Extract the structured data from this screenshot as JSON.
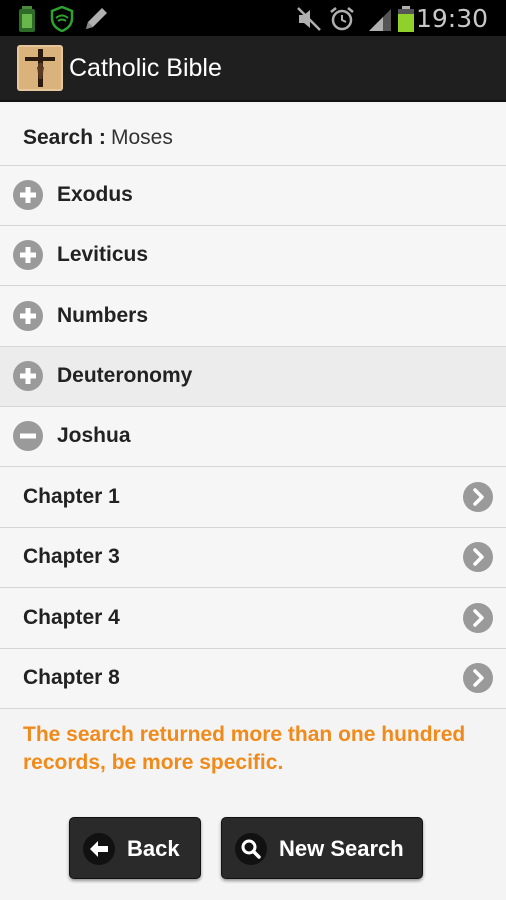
{
  "status_bar": {
    "time": "19:30",
    "icons": [
      "battery-app-icon",
      "shield-icon",
      "pencil-icon",
      "mute-icon",
      "alarm-icon",
      "signal-icon",
      "battery-icon"
    ]
  },
  "app_bar": {
    "title": "Catholic Bible",
    "logo_icon": "crucifix-icon"
  },
  "search": {
    "label": "Search :",
    "value": "Moses"
  },
  "books": [
    {
      "label": "Exodus",
      "state": "collapsed",
      "icon": "plus-circle-icon"
    },
    {
      "label": "Leviticus",
      "state": "collapsed",
      "icon": "plus-circle-icon"
    },
    {
      "label": "Numbers",
      "state": "collapsed",
      "icon": "plus-circle-icon"
    },
    {
      "label": "Deuteronomy",
      "state": "collapsed",
      "icon": "plus-circle-icon"
    },
    {
      "label": "Joshua",
      "state": "expanded",
      "icon": "minus-circle-icon"
    }
  ],
  "chapters": [
    {
      "label": "Chapter 1",
      "icon": "chevron-right-icon"
    },
    {
      "label": "Chapter 3",
      "icon": "chevron-right-icon"
    },
    {
      "label": "Chapter 4",
      "icon": "chevron-right-icon"
    },
    {
      "label": "Chapter 8",
      "icon": "chevron-right-icon"
    }
  ],
  "warning": "The search returned more than one hundred records, be more specific.",
  "buttons": {
    "back": {
      "label": "Back",
      "icon": "arrow-left-icon"
    },
    "new_search": {
      "label": "New Search",
      "icon": "magnifier-icon"
    }
  },
  "colors": {
    "action_bar": "#1f1f1f",
    "warning": "#f08a1a",
    "icon_gray": "#9a9a9a"
  }
}
